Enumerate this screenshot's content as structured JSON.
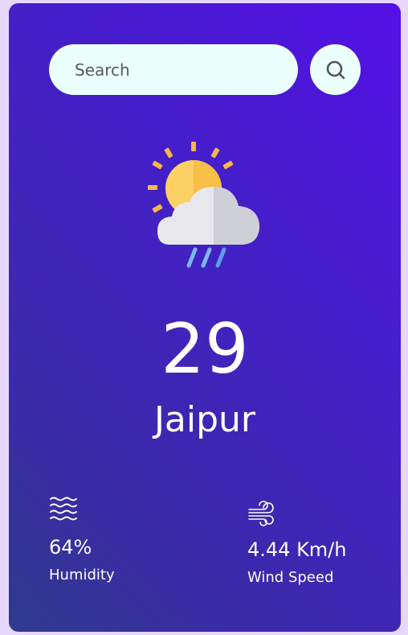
{
  "search": {
    "placeholder": "Search",
    "value": ""
  },
  "weather": {
    "icon": "sun-cloud-rain-icon",
    "temperature": "29",
    "city": "Jaipur"
  },
  "details": {
    "humidity": {
      "value": "64%",
      "label": "Humidity",
      "icon": "waves-icon"
    },
    "wind": {
      "value": "4.44 Km/h",
      "label": "Wind Speed",
      "icon": "wind-icon"
    }
  },
  "colors": {
    "card_gradient_start": "#5410e6",
    "card_gradient_end": "#2f3b8d",
    "input_bg": "#ebfffc",
    "text": "#ffffff"
  }
}
